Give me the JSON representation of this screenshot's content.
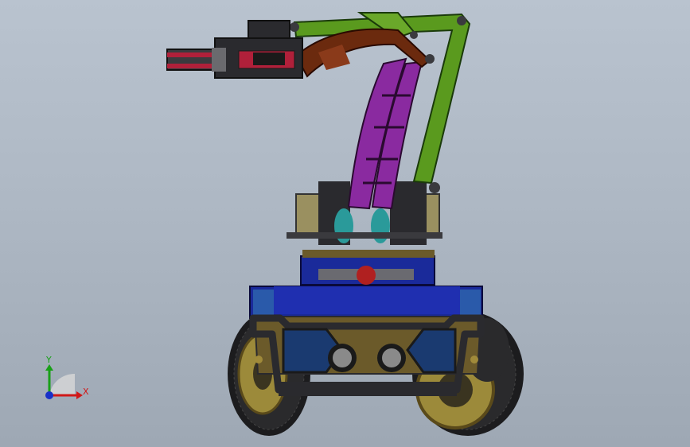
{
  "scene": {
    "subject": "robot-arm-on-wheeled-base",
    "colors": {
      "background": "#b3bdc9",
      "arm_green": "#5a9a1e",
      "arm_purple": "#8a2aa0",
      "arm_brown": "#6b2a0e",
      "gripper_red": "#b0203a",
      "base_blue": "#1a2a9a",
      "base_olive": "#6b5a2a",
      "frame_dark": "#2a2a2e",
      "tire": "#1c1c1e",
      "rim_gold": "#9c8a3a"
    }
  },
  "triad": {
    "x_label": "X",
    "y_label": "Y",
    "x_color": "#d01818",
    "y_color": "#18a018",
    "origin_color": "#1830c8"
  }
}
